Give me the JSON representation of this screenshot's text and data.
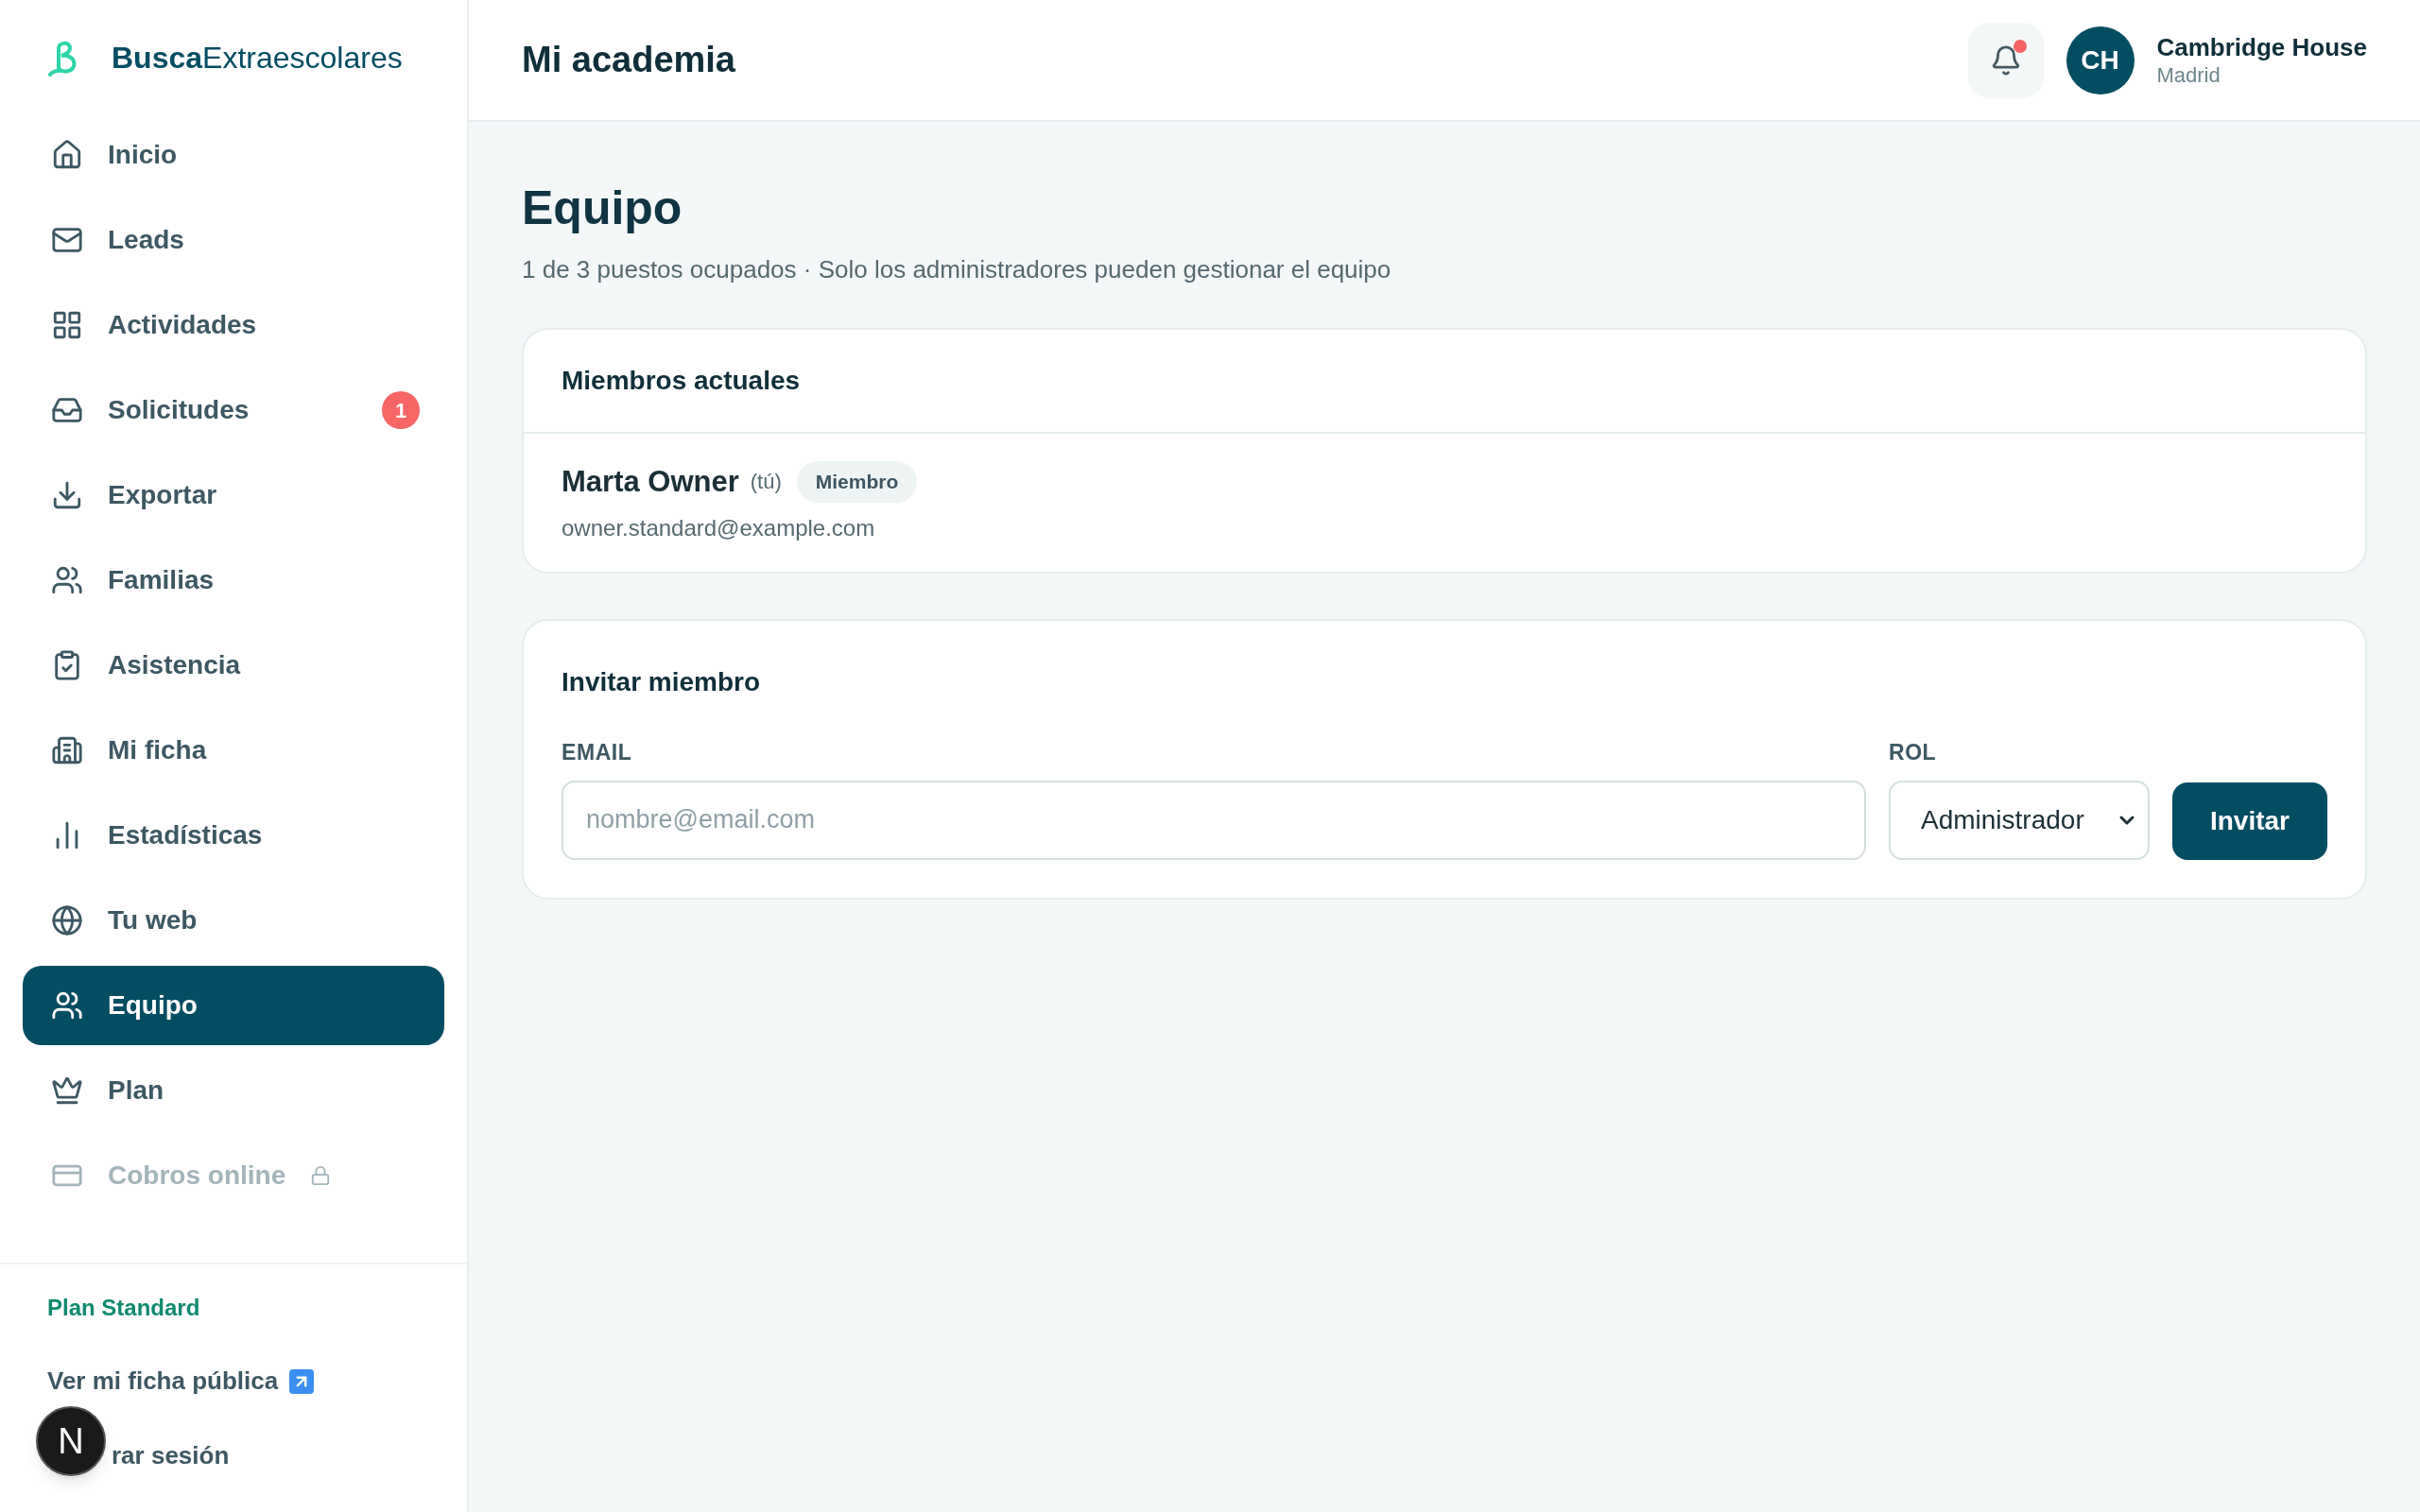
{
  "brand": {
    "bold": "Busca",
    "rest": "Extraescolares"
  },
  "sidebar": {
    "items": [
      {
        "label": "Inicio",
        "selected": false,
        "disabled": false
      },
      {
        "label": "Leads",
        "selected": false,
        "disabled": false
      },
      {
        "label": "Actividades",
        "selected": false,
        "disabled": false
      },
      {
        "label": "Solicitudes",
        "selected": false,
        "disabled": false,
        "badge": "1"
      },
      {
        "label": "Exportar",
        "selected": false,
        "disabled": false
      },
      {
        "label": "Familias",
        "selected": false,
        "disabled": false
      },
      {
        "label": "Asistencia",
        "selected": false,
        "disabled": false
      },
      {
        "label": "Mi ficha",
        "selected": false,
        "disabled": false
      },
      {
        "label": "Estadísticas",
        "selected": false,
        "disabled": false
      },
      {
        "label": "Tu web",
        "selected": false,
        "disabled": false
      },
      {
        "label": "Equipo",
        "selected": true,
        "disabled": false
      },
      {
        "label": "Plan",
        "selected": false,
        "disabled": false
      },
      {
        "label": "Cobros online",
        "selected": false,
        "disabled": true
      }
    ],
    "plan": "Plan Standard",
    "public_link": "Ver mi ficha pública",
    "logout": "rar sesión"
  },
  "dev_badge": "N",
  "header": {
    "title": "Mi academia",
    "notifications_unread": true,
    "avatar": "CH",
    "org_name": "Cambridge House",
    "org_city": "Madrid"
  },
  "page": {
    "title": "Equipo",
    "subtitle": "1 de 3 puestos ocupados · Solo los administradores pueden gestionar el equipo"
  },
  "members": {
    "title": "Miembros actuales",
    "rows": [
      {
        "name": "Marta Owner",
        "you": "(tú)",
        "role": "Miembro",
        "email": "owner.standard@example.com"
      }
    ]
  },
  "invite": {
    "title": "Invitar miembro",
    "email_label": "EMAIL",
    "email_placeholder": "nombre@email.com",
    "role_label": "ROL",
    "role_value": "Administrador",
    "button": "Invitar"
  }
}
